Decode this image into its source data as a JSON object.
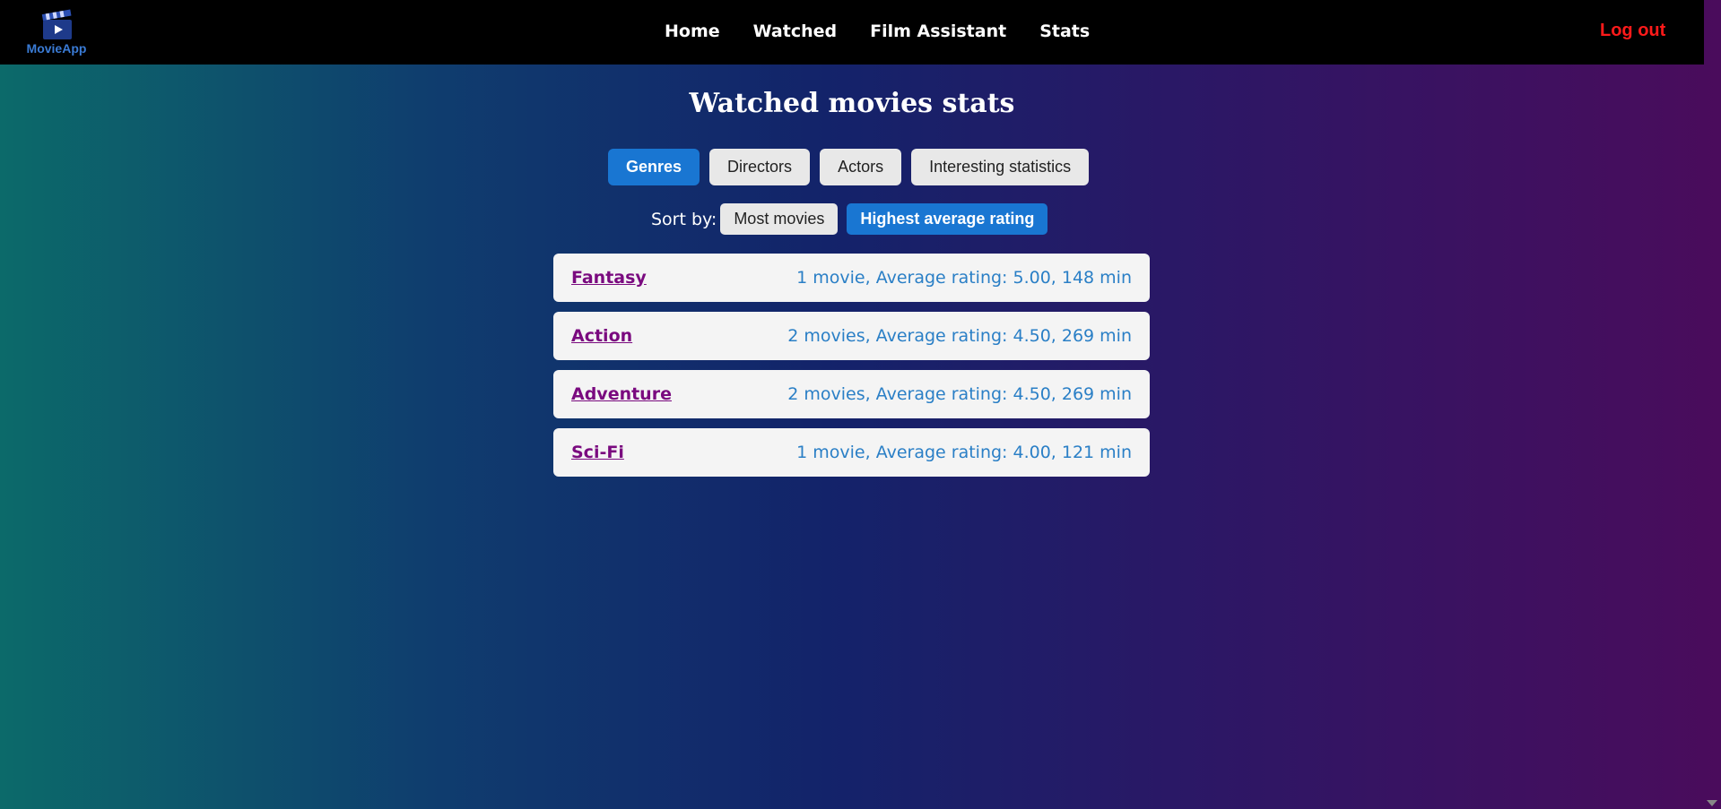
{
  "app": {
    "logo_text": "MovieApp"
  },
  "nav": {
    "links": [
      {
        "label": "Home"
      },
      {
        "label": "Watched"
      },
      {
        "label": "Film Assistant"
      },
      {
        "label": "Stats"
      }
    ],
    "logout_label": "Log out"
  },
  "page": {
    "title": "Watched movies stats"
  },
  "tabs": [
    {
      "label": "Genres",
      "active": true
    },
    {
      "label": "Directors",
      "active": false
    },
    {
      "label": "Actors",
      "active": false
    },
    {
      "label": "Interesting statistics",
      "active": false
    }
  ],
  "sort": {
    "label": "Sort by:",
    "options": [
      {
        "label": "Most movies",
        "active": false
      },
      {
        "label": "Highest average rating",
        "active": true
      }
    ]
  },
  "genres": [
    {
      "name": "Fantasy",
      "stats": "1 movie, Average rating: 5.00, 148 min"
    },
    {
      "name": "Action",
      "stats": "2 movies, Average rating: 4.50, 269 min"
    },
    {
      "name": "Adventure",
      "stats": "2 movies, Average rating: 4.50, 269 min"
    },
    {
      "name": "Sci-Fi",
      "stats": "1 movie, Average rating: 4.00, 121 min"
    }
  ],
  "colors": {
    "accent": "#1976d2",
    "logout": "#ff1a1a",
    "genre_link": "#7a0a7f",
    "stats_text": "#2a7fc6"
  }
}
